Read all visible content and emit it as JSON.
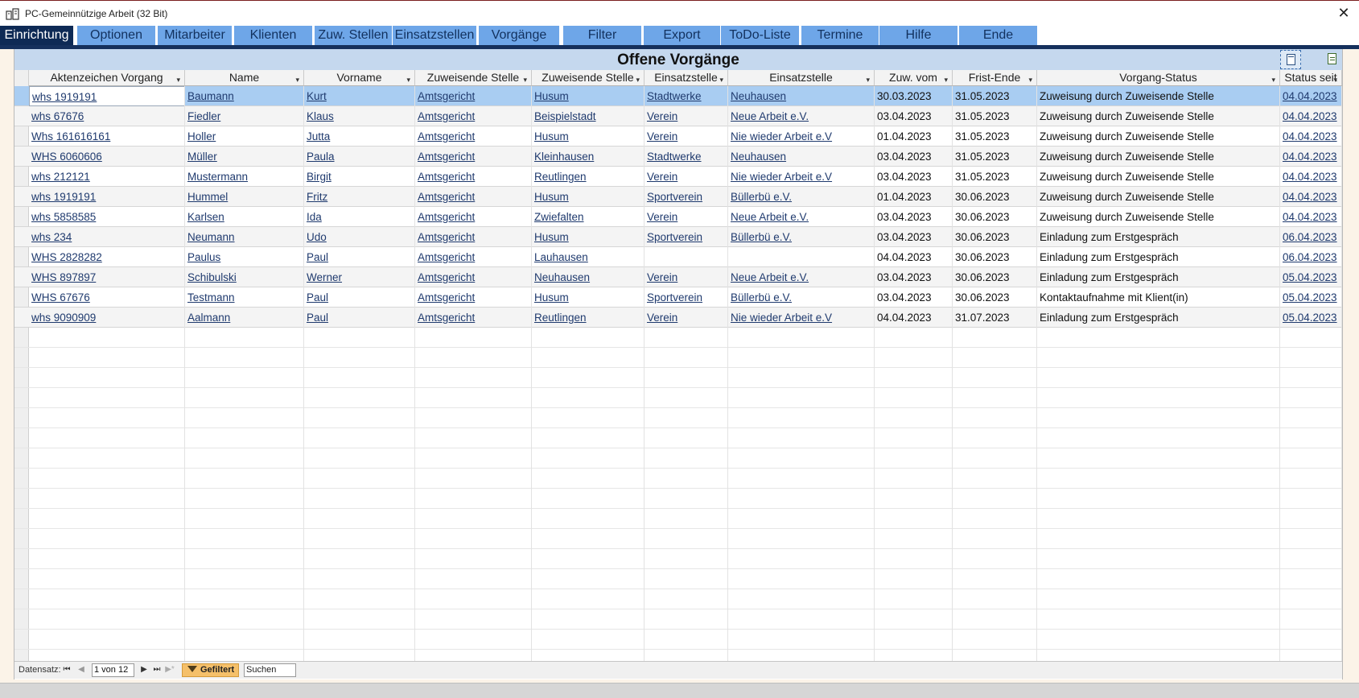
{
  "window": {
    "title": "PC-Gemeinnützige Arbeit (32 Bit)",
    "close_glyph": "✕"
  },
  "menu": [
    {
      "label": "Einrichtung",
      "active": true
    },
    {
      "label": "Optionen"
    },
    {
      "label": "Mitarbeiter"
    },
    {
      "label": "Klienten"
    },
    {
      "label": "Zuw. Stellen"
    },
    {
      "label": "Einsatzstellen"
    },
    {
      "label": "Vorgänge"
    },
    {
      "label": "Filter"
    },
    {
      "label": "Export"
    },
    {
      "label": "ToDo-Liste"
    },
    {
      "label": "Termine"
    },
    {
      "label": "Hilfe"
    },
    {
      "label": "Ende"
    }
  ],
  "form": {
    "title": "Offene Vorgänge"
  },
  "columns": [
    "Aktenzeichen Vorgang",
    "Name",
    "Vorname",
    "Zuweisende Stelle",
    "Zuweisende Stelle",
    "Einsatzstelle",
    "Einsatzstelle",
    "Zuw. vom",
    "Frist-Ende",
    "Vorgang-Status",
    "Status seit"
  ],
  "rows": [
    [
      "whs 1919191",
      "Baumann",
      "Kurt",
      "Amtsgericht",
      "Husum",
      "Stadtwerke",
      "Neuhausen",
      "30.03.2023",
      "31.05.2023",
      "Zuweisung durch Zuweisende Stelle",
      "04.04.2023"
    ],
    [
      "whs 67676",
      "Fiedler",
      "Klaus",
      "Amtsgericht",
      "Beispielstadt",
      "Verein",
      "Neue Arbeit e.V.",
      "03.04.2023",
      "31.05.2023",
      "Zuweisung durch Zuweisende Stelle",
      "04.04.2023"
    ],
    [
      "Whs 161616161",
      "Holler",
      "Jutta",
      "Amtsgericht",
      "Husum",
      "Verein",
      "Nie wieder Arbeit e.V",
      "01.04.2023",
      "31.05.2023",
      "Zuweisung durch Zuweisende Stelle",
      "04.04.2023"
    ],
    [
      "WHS 6060606",
      "Müller",
      "Paula",
      "Amtsgericht",
      "Kleinhausen",
      "Stadtwerke",
      "Neuhausen",
      "03.04.2023",
      "31.05.2023",
      "Zuweisung durch Zuweisende Stelle",
      "04.04.2023"
    ],
    [
      "whs 212121",
      "Mustermann",
      "Birgit",
      "Amtsgericht",
      "Reutlingen",
      "Verein",
      "Nie wieder Arbeit e.V",
      "03.04.2023",
      "31.05.2023",
      "Zuweisung durch Zuweisende Stelle",
      "04.04.2023"
    ],
    [
      "whs 1919191",
      "Hummel",
      "Fritz",
      "Amtsgericht",
      "Husum",
      "Sportverein",
      "Büllerbü e.V.",
      "01.04.2023",
      "30.06.2023",
      "Zuweisung durch Zuweisende Stelle",
      "04.04.2023"
    ],
    [
      "whs 5858585",
      "Karlsen",
      "Ida",
      "Amtsgericht",
      "Zwiefalten",
      "Verein",
      "Neue Arbeit e.V.",
      "03.04.2023",
      "30.06.2023",
      "Zuweisung durch Zuweisende Stelle",
      "04.04.2023"
    ],
    [
      "whs 234",
      "Neumann",
      "Udo",
      "Amtsgericht",
      "Husum",
      "Sportverein",
      "Büllerbü e.V.",
      "03.04.2023",
      "30.06.2023",
      "Einladung zum Erstgespräch",
      "06.04.2023"
    ],
    [
      "WHS 2828282",
      "Paulus",
      "Paul",
      "Amtsgericht",
      "Lauhausen",
      "",
      "",
      "04.04.2023",
      "30.06.2023",
      "Einladung zum Erstgespräch",
      "06.04.2023"
    ],
    [
      "WHS 897897",
      "Schibulski",
      "Werner",
      "Amtsgericht",
      "Neuhausen",
      "Verein",
      "Neue Arbeit e.V.",
      "03.04.2023",
      "30.06.2023",
      "Einladung zum Erstgespräch",
      "05.04.2023"
    ],
    [
      "WHS 67676",
      "Testmann",
      "Paul",
      "Amtsgericht",
      "Husum",
      "Sportverein",
      "Büllerbü e.V.",
      "03.04.2023",
      "30.06.2023",
      "Kontaktaufnahme mit Klient(in)",
      "05.04.2023"
    ],
    [
      "whs 9090909",
      "Aalmann",
      "Paul",
      "Amtsgericht",
      "Reutlingen",
      "Verein",
      "Nie wieder Arbeit e.V",
      "04.04.2023",
      "31.07.2023",
      "Einladung zum Erstgespräch",
      "05.04.2023"
    ]
  ],
  "navigation": {
    "label": "Datensatz:",
    "counter": "1 von 12",
    "filter_label": "Gefiltert",
    "search_placeholder": "Suchen",
    "first_glyph": "⏮",
    "prev_glyph": "◀",
    "next_glyph": "▶",
    "last_glyph": "⏭",
    "new_glyph": "▶*"
  },
  "colors": {
    "menu_button": "#6ea6e8",
    "menu_active": "#0e2a55",
    "header_band": "#c5d8ee",
    "selected_row": "#a9cdf2",
    "link_text": "#1f3a6e",
    "filter_badge": "#f5c06a"
  }
}
